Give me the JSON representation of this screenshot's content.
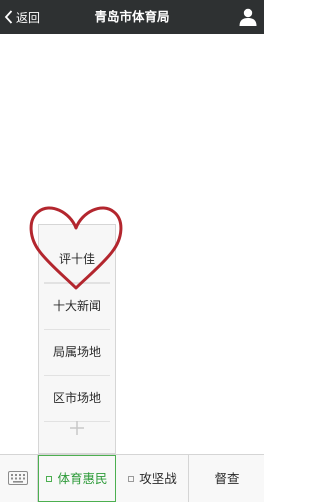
{
  "header": {
    "back_label": "返回",
    "title": "青岛市体育局",
    "back_icon": "chevron-left-icon",
    "profile_icon": "person-icon"
  },
  "submenu": {
    "items": [
      {
        "label": "评十佳"
      },
      {
        "label": "十大新闻"
      },
      {
        "label": "局属场地"
      },
      {
        "label": "区市场地"
      }
    ],
    "add_icon": "plus-icon",
    "highlight_icon": "heart-outline-icon",
    "highlight_color": "#b3262e"
  },
  "tabbar": {
    "keyboard_icon": "keyboard-icon",
    "tabs": [
      {
        "label": "体育惠民",
        "active": true,
        "has_menu": true
      },
      {
        "label": "攻坚战",
        "active": false,
        "has_menu": true
      },
      {
        "label": "督查",
        "active": false,
        "has_menu": false
      }
    ],
    "active_color": "#2e9b3a"
  }
}
